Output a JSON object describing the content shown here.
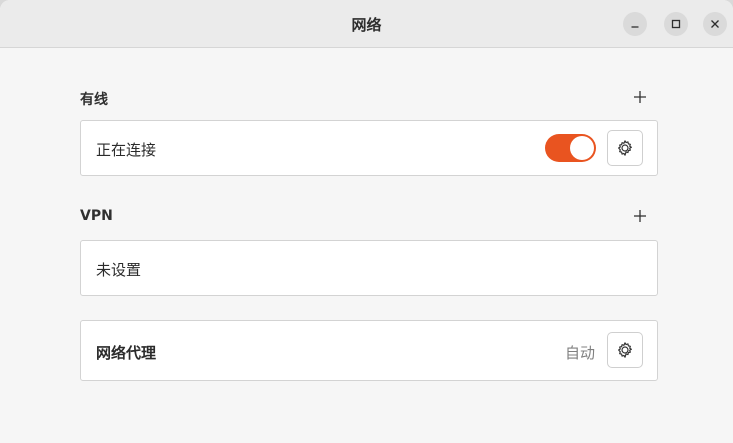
{
  "window": {
    "title": "网络",
    "controls": [
      "minimize-icon",
      "maximize-icon",
      "close-icon"
    ]
  },
  "wired": {
    "section_label": "有线",
    "add_icon": "+",
    "connection_label": "正在连接",
    "toggle_on": true
  },
  "vpn": {
    "section_label": "VPN",
    "add_icon": "+",
    "status_label": "未设置"
  },
  "proxy": {
    "label": "网络代理",
    "value": "自动"
  },
  "colors": {
    "accent": "#e95420"
  }
}
